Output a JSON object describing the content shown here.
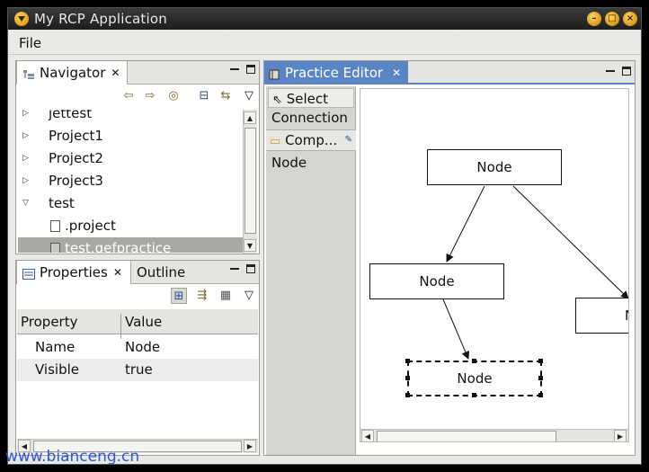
{
  "window": {
    "title": "My RCP Application"
  },
  "menu": {
    "file": "File"
  },
  "navigator": {
    "tab_label": "Navigator",
    "items": [
      {
        "label": "jettest",
        "expanded": false
      },
      {
        "label": "Project1",
        "expanded": false
      },
      {
        "label": "Project2",
        "expanded": false
      },
      {
        "label": "Project3",
        "expanded": false
      },
      {
        "label": "test",
        "expanded": true
      },
      {
        "label": ".project",
        "child": true
      },
      {
        "label": "test.gefpractice",
        "child": true,
        "selected": true
      }
    ]
  },
  "properties": {
    "tab_label": "Properties",
    "outline_tab_label": "Outline",
    "columns": [
      "Property",
      "Value"
    ],
    "rows": [
      {
        "name": "Name",
        "value": "Node"
      },
      {
        "name": "Visible",
        "value": "true"
      }
    ]
  },
  "editor": {
    "tab_label": "Practice Editor",
    "palette": {
      "select": "Select",
      "connection": "Connection",
      "drawer": "Comp...",
      "node": "Node"
    },
    "nodes": [
      {
        "label": "Node"
      },
      {
        "label": "Node"
      },
      {
        "label": "Node",
        "selected": true
      },
      {
        "label": "N"
      }
    ]
  },
  "watermark": "www.bianceng.cn"
}
